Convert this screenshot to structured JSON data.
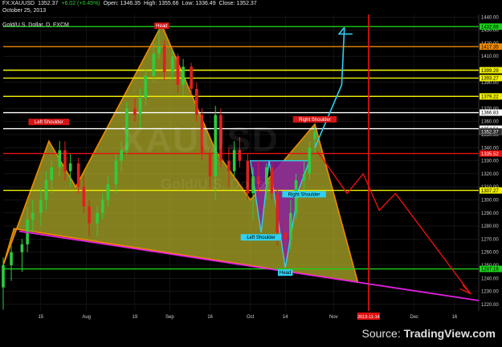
{
  "header": {
    "symbol": "FX:XAUUSD",
    "last": "1352.37",
    "change": "+6.02 (+0.45%)",
    "open": "Open: 1346.35",
    "high": "High: 1355.66",
    "low": "Low: 1336.49",
    "close": "Close: 1352.37",
    "date": "October 25, 2013",
    "series_name": "Gold/U.S. Dollar, D, FXCM"
  },
  "watermark": {
    "ticker": "XAUUSD",
    "sub": "Gold/U.S. Dollar"
  },
  "source": {
    "prefix": "Source: ",
    "brand": "TradingView.com"
  },
  "colors": {
    "up": "#2ecc40",
    "down": "#e02020",
    "green": "#19d219",
    "orange": "#f08a00",
    "yellow": "#f0f000",
    "white": "#ffffff",
    "red": "#e81010",
    "magenta": "#e020e0",
    "cyan": "#30d0f0",
    "pattern_fill": "#b5b02a",
    "inner_fill": "#8a20a0"
  },
  "chart_data": {
    "type": "candlestick",
    "x_ticks": [
      "15",
      "Aug",
      "19",
      "Sep",
      "16",
      "Oct",
      "14",
      "Nov",
      "2013-11-14",
      "Dec",
      "16"
    ],
    "y_ticks": [
      1220,
      1230,
      1240,
      1250,
      1260,
      1270,
      1280,
      1290,
      1300,
      1310,
      1320,
      1330,
      1340,
      1350,
      1360,
      1370,
      1380,
      1390,
      1400,
      1410,
      1420,
      1430,
      1440
    ],
    "ylim": [
      1215,
      1442
    ],
    "x_range": [
      "2013-07-01",
      "2013-12-25"
    ],
    "levels": [
      {
        "value": 1432.66,
        "label": "1432.66",
        "color": "green"
      },
      {
        "value": 1417.35,
        "label": "1417.35",
        "color": "orange"
      },
      {
        "value": 1399.29,
        "label": "1399.29",
        "color": "yellow"
      },
      {
        "value": 1393.27,
        "label": "1393.27",
        "color": "yellow"
      },
      {
        "value": 1379.22,
        "label": "1379.22",
        "color": "yellow"
      },
      {
        "value": 1366.83,
        "label": "1366.83",
        "color": "white"
      },
      {
        "value": 1354.51,
        "label": "1354.51",
        "color": "white"
      },
      {
        "value": 1335.52,
        "label": "1335.52",
        "color": "red"
      },
      {
        "value": 1307.27,
        "label": "1307.27",
        "color": "yellow"
      },
      {
        "value": 1247.18,
        "label": "1247.18",
        "color": "green"
      }
    ],
    "last_price": {
      "value": 1352.37,
      "label": "1352.37"
    },
    "vline": {
      "date": "2013-11-14",
      "label": "2013-11-14"
    },
    "candles": [
      {
        "d": "2013-07-01",
        "o": 1233,
        "h": 1256,
        "l": 1216,
        "c": 1250
      },
      {
        "d": "2013-07-04",
        "o": 1250,
        "h": 1265,
        "l": 1238,
        "c": 1260
      },
      {
        "d": "2013-07-08",
        "o": 1260,
        "h": 1270,
        "l": 1245,
        "c": 1266
      },
      {
        "d": "2013-07-10",
        "o": 1266,
        "h": 1295,
        "l": 1260,
        "c": 1285
      },
      {
        "d": "2013-07-12",
        "o": 1285,
        "h": 1300,
        "l": 1275,
        "c": 1290
      },
      {
        "d": "2013-07-15",
        "o": 1290,
        "h": 1308,
        "l": 1280,
        "c": 1300
      },
      {
        "d": "2013-07-17",
        "o": 1300,
        "h": 1322,
        "l": 1292,
        "c": 1315
      },
      {
        "d": "2013-07-19",
        "o": 1315,
        "h": 1330,
        "l": 1305,
        "c": 1325
      },
      {
        "d": "2013-07-22",
        "o": 1325,
        "h": 1345,
        "l": 1318,
        "c": 1338
      },
      {
        "d": "2013-07-24",
        "o": 1338,
        "h": 1345,
        "l": 1315,
        "c": 1322
      },
      {
        "d": "2013-07-26",
        "o": 1322,
        "h": 1335,
        "l": 1310,
        "c": 1328
      },
      {
        "d": "2013-07-29",
        "o": 1328,
        "h": 1332,
        "l": 1305,
        "c": 1310
      },
      {
        "d": "2013-07-31",
        "o": 1310,
        "h": 1318,
        "l": 1290,
        "c": 1295
      },
      {
        "d": "2013-08-02",
        "o": 1295,
        "h": 1300,
        "l": 1272,
        "c": 1282
      },
      {
        "d": "2013-08-05",
        "o": 1282,
        "h": 1295,
        "l": 1272,
        "c": 1290
      },
      {
        "d": "2013-08-07",
        "o": 1290,
        "h": 1305,
        "l": 1285,
        "c": 1300
      },
      {
        "d": "2013-08-09",
        "o": 1300,
        "h": 1318,
        "l": 1295,
        "c": 1312
      },
      {
        "d": "2013-08-12",
        "o": 1312,
        "h": 1335,
        "l": 1305,
        "c": 1330
      },
      {
        "d": "2013-08-14",
        "o": 1330,
        "h": 1345,
        "l": 1322,
        "c": 1338
      },
      {
        "d": "2013-08-16",
        "o": 1338,
        "h": 1375,
        "l": 1335,
        "c": 1370
      },
      {
        "d": "2013-08-19",
        "o": 1370,
        "h": 1378,
        "l": 1360,
        "c": 1365
      },
      {
        "d": "2013-08-21",
        "o": 1365,
        "h": 1385,
        "l": 1355,
        "c": 1378
      },
      {
        "d": "2013-08-23",
        "o": 1378,
        "h": 1400,
        "l": 1372,
        "c": 1395
      },
      {
        "d": "2013-08-26",
        "o": 1395,
        "h": 1420,
        "l": 1390,
        "c": 1412
      },
      {
        "d": "2013-08-28",
        "o": 1412,
        "h": 1434,
        "l": 1408,
        "c": 1418
      },
      {
        "d": "2013-08-30",
        "o": 1418,
        "h": 1422,
        "l": 1392,
        "c": 1398
      },
      {
        "d": "2013-09-02",
        "o": 1398,
        "h": 1415,
        "l": 1392,
        "c": 1410
      },
      {
        "d": "2013-09-04",
        "o": 1410,
        "h": 1412,
        "l": 1382,
        "c": 1388
      },
      {
        "d": "2013-09-06",
        "o": 1388,
        "h": 1408,
        "l": 1380,
        "c": 1402
      },
      {
        "d": "2013-09-09",
        "o": 1402,
        "h": 1405,
        "l": 1380,
        "c": 1385
      },
      {
        "d": "2013-09-11",
        "o": 1385,
        "h": 1390,
        "l": 1360,
        "c": 1365
      },
      {
        "d": "2013-09-13",
        "o": 1365,
        "h": 1370,
        "l": 1330,
        "c": 1335
      },
      {
        "d": "2013-09-16",
        "o": 1335,
        "h": 1340,
        "l": 1308,
        "c": 1318
      },
      {
        "d": "2013-09-18",
        "o": 1318,
        "h": 1372,
        "l": 1300,
        "c": 1365
      },
      {
        "d": "2013-09-20",
        "o": 1365,
        "h": 1370,
        "l": 1325,
        "c": 1330
      },
      {
        "d": "2013-09-23",
        "o": 1330,
        "h": 1340,
        "l": 1310,
        "c": 1322
      },
      {
        "d": "2013-09-25",
        "o": 1322,
        "h": 1345,
        "l": 1318,
        "c": 1338
      },
      {
        "d": "2013-09-27",
        "o": 1338,
        "h": 1348,
        "l": 1325,
        "c": 1330
      },
      {
        "d": "2013-09-30",
        "o": 1330,
        "h": 1335,
        "l": 1300,
        "c": 1305
      },
      {
        "d": "2013-10-02",
        "o": 1305,
        "h": 1325,
        "l": 1285,
        "c": 1318
      },
      {
        "d": "2013-10-04",
        "o": 1318,
        "h": 1330,
        "l": 1305,
        "c": 1312
      },
      {
        "d": "2013-10-07",
        "o": 1312,
        "h": 1328,
        "l": 1300,
        "c": 1325
      },
      {
        "d": "2013-10-09",
        "o": 1325,
        "h": 1328,
        "l": 1300,
        "c": 1305
      },
      {
        "d": "2013-10-11",
        "o": 1305,
        "h": 1310,
        "l": 1265,
        "c": 1275
      },
      {
        "d": "2013-10-14",
        "o": 1275,
        "h": 1285,
        "l": 1252,
        "c": 1270
      },
      {
        "d": "2013-10-16",
        "o": 1270,
        "h": 1300,
        "l": 1262,
        "c": 1290
      },
      {
        "d": "2013-10-18",
        "o": 1290,
        "h": 1320,
        "l": 1285,
        "c": 1315
      },
      {
        "d": "2013-10-21",
        "o": 1315,
        "h": 1330,
        "l": 1308,
        "c": 1320
      },
      {
        "d": "2013-10-23",
        "o": 1320,
        "h": 1345,
        "l": 1315,
        "c": 1340
      },
      {
        "d": "2013-10-25",
        "o": 1346.35,
        "h": 1355.66,
        "l": 1336.49,
        "c": 1352.37
      }
    ],
    "annotations": [
      {
        "text": "Head",
        "date": "2013-08-29",
        "value": 1437,
        "bg": "#d41515",
        "fg": "#ffffff",
        "pos": "below"
      },
      {
        "text": "Left Shoulder",
        "date": "2013-07-18",
        "value": 1356,
        "bg": "#d41515",
        "fg": "#ffffff",
        "pos": "above"
      },
      {
        "text": "Right Shoulder",
        "date": "2013-10-25",
        "value": 1358,
        "bg": "#d41515",
        "fg": "#ffffff",
        "pos": "above"
      },
      {
        "text": "Left Shoulder",
        "date": "2013-10-05",
        "value": 1275,
        "bg": "#30d0f0",
        "fg": "#000000",
        "pos": "below"
      },
      {
        "text": "Head",
        "date": "2013-10-14",
        "value": 1248,
        "bg": "#30d0f0",
        "fg": "#000000",
        "pos": "below"
      },
      {
        "text": "Right Shoulder",
        "date": "2013-10-21",
        "value": 1308,
        "bg": "#30d0f0",
        "fg": "#000000",
        "pos": "below"
      }
    ]
  }
}
